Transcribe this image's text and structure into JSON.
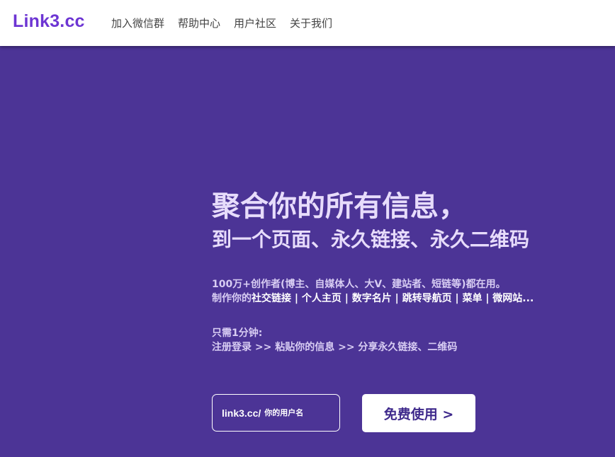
{
  "header": {
    "logo": "Link3.cc",
    "nav": [
      {
        "label": "加入微信群"
      },
      {
        "label": "帮助中心"
      },
      {
        "label": "用户社区"
      },
      {
        "label": "关于我们"
      }
    ]
  },
  "hero": {
    "headline": "聚合你的所有信息，",
    "subheadline": "到一个页面、永久链接、永久二维码",
    "users_line": "100万+创作者(博主、自媒体人、大V、建站者、短链等)都在用。",
    "uses_prefix": "制作你的",
    "uses_items": "社交链接 | 个人主页 | 数字名片 | 跳转导航页 | 菜单 | 微网站...",
    "steps_title": "只需1分钟:",
    "steps_line": "注册登录 >> 粘贴你的信息 >> 分享永久链接、二维码"
  },
  "signup": {
    "url_prefix": "link3.cc/",
    "username_placeholder": "你的用户名",
    "cta_label": "免费使用 >"
  },
  "colors": {
    "background": "#4c3496",
    "logo": "#6d35d3",
    "headline": "#e7dcfb"
  }
}
